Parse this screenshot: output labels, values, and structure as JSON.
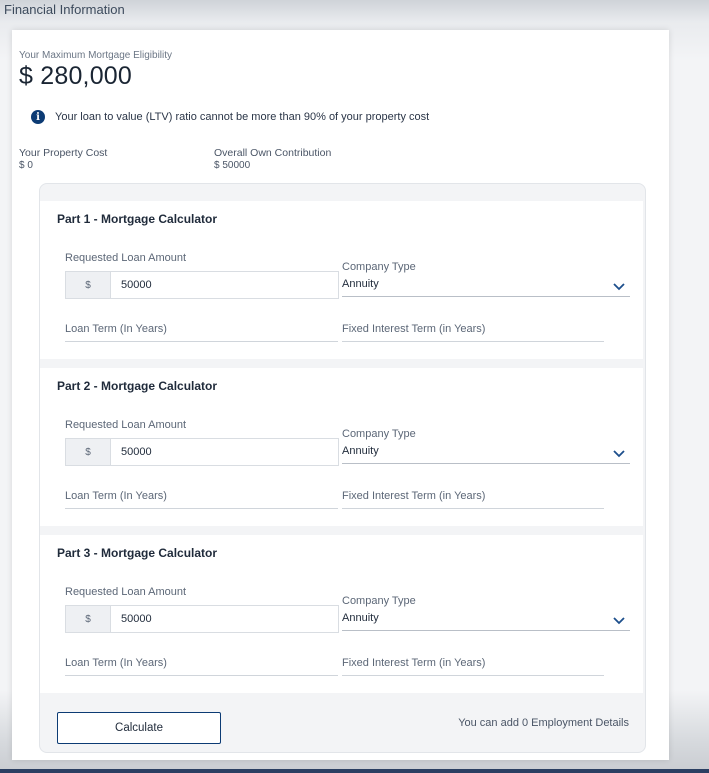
{
  "header": {
    "title": "Financial Information"
  },
  "eligibility": {
    "label": "Your Maximum Mortgage Eligibility",
    "amount": "$ 280,000"
  },
  "info": {
    "icon": "info-icon",
    "text": "Your loan to value (LTV) ratio cannot be more than 90% of your property cost"
  },
  "stats": {
    "property_cost_label": "Your Property Cost",
    "property_cost_value": "$ 0",
    "contribution_label": "Overall Own Contribution",
    "contribution_value": "$ 50000"
  },
  "sections": [
    {
      "title": "Part 1 - Mortgage Calculator",
      "loan_amount_label": "Requested Loan Amount",
      "currency": "$",
      "loan_amount_value": "50000",
      "company_type_label": "Company Type",
      "company_type_value": "Annuity",
      "loan_term_placeholder": "Loan Term (In Years)",
      "fixed_term_placeholder": "Fixed Interest Term (in Years)"
    },
    {
      "title": "Part 2 - Mortgage Calculator",
      "loan_amount_label": "Requested Loan Amount",
      "currency": "$",
      "loan_amount_value": "50000",
      "company_type_label": "Company Type",
      "company_type_value": "Annuity",
      "loan_term_placeholder": "Loan Term (In Years)",
      "fixed_term_placeholder": "Fixed Interest Term (in Years)"
    },
    {
      "title": "Part 3 - Mortgage Calculator",
      "loan_amount_label": "Requested Loan Amount",
      "currency": "$",
      "loan_amount_value": "50000",
      "company_type_label": "Company Type",
      "company_type_value": "Annuity",
      "loan_term_placeholder": "Loan Term (In Years)",
      "fixed_term_placeholder": "Fixed Interest Term (in Years)"
    }
  ],
  "footer": {
    "calculate_label": "Calculate",
    "employment_text": "You can add 0 Employment Details"
  },
  "colors": {
    "accent": "#0c3b74",
    "chevron": "#1d4f8c"
  }
}
